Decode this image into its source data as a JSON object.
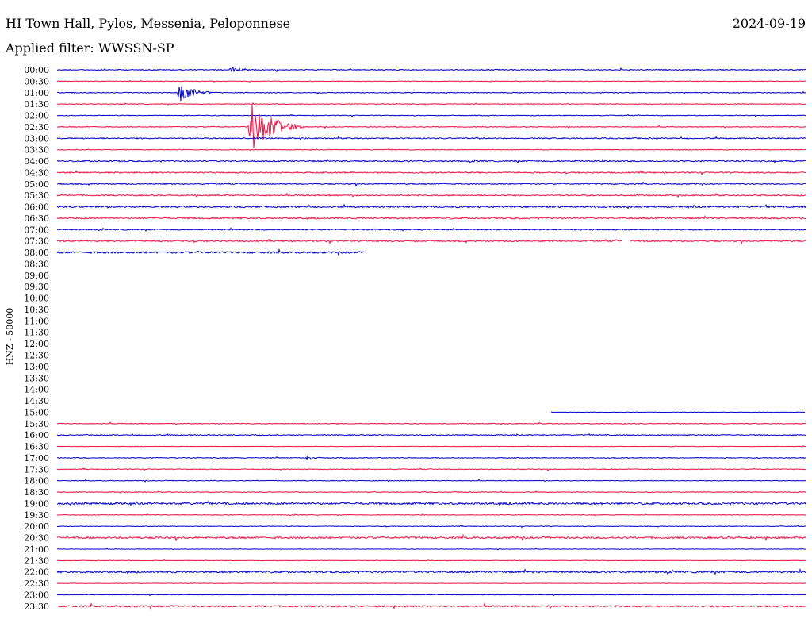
{
  "header": {
    "title": "HI Town Hall, Pylos, Messenia, Peloponnese",
    "date": "2024-09-19",
    "filter": "Applied filter: WWSSN-SP"
  },
  "chart_data": {
    "type": "line",
    "chart_kind": "helicorder",
    "ylabel": "HNZ - 50000",
    "row_labels": [
      "00:00",
      "00:30",
      "01:00",
      "01:30",
      "02:00",
      "02:30",
      "03:00",
      "03:30",
      "04:00",
      "04:30",
      "05:00",
      "05:30",
      "06:00",
      "06:30",
      "07:00",
      "07:30",
      "08:00",
      "08:30",
      "09:00",
      "09:30",
      "10:00",
      "10:30",
      "11:00",
      "11:30",
      "12:00",
      "12:30",
      "13:00",
      "13:30",
      "14:00",
      "14:30",
      "15:00",
      "15:30",
      "16:00",
      "16:30",
      "17:00",
      "17:30",
      "18:00",
      "18:30",
      "19:00",
      "19:30",
      "20:00",
      "20:30",
      "21:00",
      "21:30",
      "22:00",
      "22:30",
      "23:00",
      "23:30"
    ],
    "row_duration_minutes": 30,
    "colors": {
      "even_rows": "#0000cc",
      "odd_rows": "#ee1144"
    },
    "row_coverage": [
      [
        0,
        1
      ],
      [
        0,
        1
      ],
      [
        0,
        1
      ],
      [
        0,
        1
      ],
      [
        0,
        1
      ],
      [
        0,
        1
      ],
      [
        0,
        1
      ],
      [
        0,
        1
      ],
      [
        0,
        1
      ],
      [
        0,
        1
      ],
      [
        0,
        1
      ],
      [
        0,
        1
      ],
      [
        0,
        1
      ],
      [
        0,
        1
      ],
      [
        0,
        1
      ],
      [
        0,
        1
      ],
      [
        0,
        0.41
      ],
      null,
      null,
      null,
      null,
      null,
      null,
      null,
      null,
      null,
      null,
      null,
      null,
      null,
      [
        0.66,
        1
      ],
      [
        0,
        1
      ],
      [
        0,
        1
      ],
      [
        0,
        1
      ],
      [
        0,
        1
      ],
      [
        0,
        1
      ],
      [
        0,
        1
      ],
      [
        0,
        1
      ],
      [
        0,
        1
      ],
      [
        0,
        1
      ],
      [
        0,
        1
      ],
      [
        0,
        1
      ],
      [
        0,
        1
      ],
      [
        0,
        1
      ],
      [
        0,
        1
      ],
      [
        0,
        1
      ],
      [
        0,
        1
      ],
      [
        0,
        1
      ]
    ],
    "noise_level": [
      1.2,
      0.8,
      1.0,
      0.9,
      0.9,
      1.0,
      1.4,
      0.9,
      1.6,
      1.6,
      1.4,
      1.5,
      2.0,
      1.9,
      1.4,
      1.8,
      2.2,
      0,
      0,
      0,
      0,
      0,
      0,
      0,
      0,
      0,
      0,
      0,
      0,
      0,
      0.5,
      1.0,
      1.2,
      0.6,
      1.0,
      1.0,
      0.8,
      0.9,
      2.4,
      0.8,
      0.8,
      2.2,
      0.6,
      0.6,
      2.2,
      0.6,
      0.6,
      2.0
    ],
    "gaps": [
      {
        "row": 15,
        "from": 0.755,
        "to": 0.765
      }
    ],
    "events": [
      {
        "row": 0,
        "position": 0.23,
        "amplitude": 4,
        "duration": 0.013
      },
      {
        "row": 2,
        "position": 0.16,
        "amplitude": 14,
        "duration": 0.018
      },
      {
        "row": 5,
        "position": 0.255,
        "amplitude": 36,
        "duration": 0.025
      },
      {
        "row": 34,
        "position": 0.33,
        "amplitude": 6,
        "duration": 0.008
      }
    ]
  }
}
